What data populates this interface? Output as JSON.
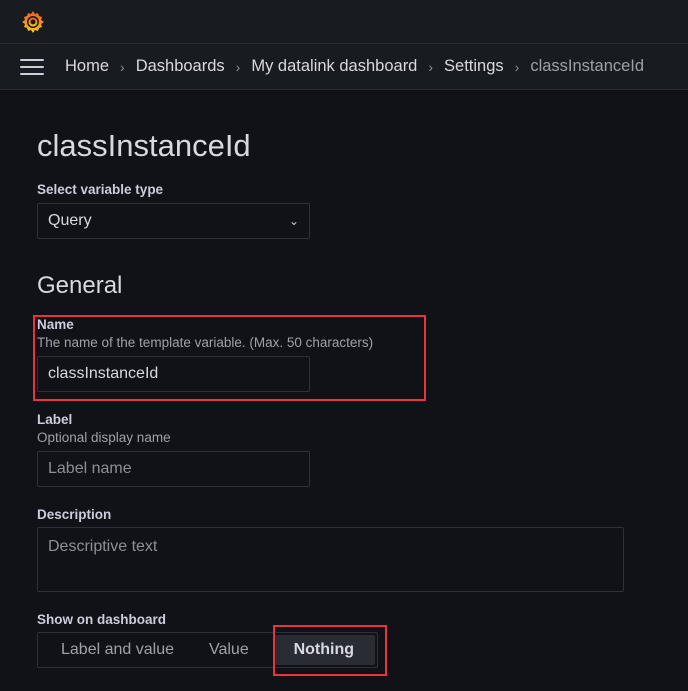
{
  "breadcrumbs": [
    "Home",
    "Dashboards",
    "My datalink dashboard",
    "Settings",
    "classInstanceId"
  ],
  "page_title": "classInstanceId",
  "variable_type": {
    "label": "Select variable type",
    "value": "Query"
  },
  "section_general": "General",
  "name": {
    "label": "Name",
    "description": "The name of the template variable. (Max. 50 characters)",
    "value": "classInstanceId"
  },
  "label": {
    "label": "Label",
    "description": "Optional display name",
    "placeholder": "Label name"
  },
  "description": {
    "label": "Description",
    "placeholder": "Descriptive text"
  },
  "show_on_dashboard": {
    "label": "Show on dashboard",
    "options": [
      "Label and value",
      "Value",
      "Nothing"
    ],
    "selected": "Nothing"
  },
  "colors": {
    "highlight": "#e5363d",
    "logo": "#f46800"
  }
}
